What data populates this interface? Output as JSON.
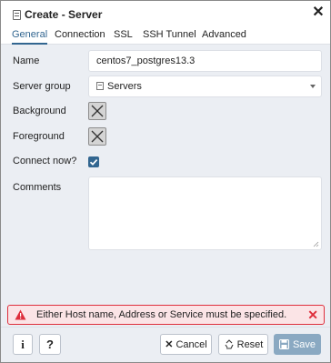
{
  "dialog": {
    "title": "Create - Server",
    "close_glyph": "✕"
  },
  "tabs": [
    {
      "label": "General",
      "active": true
    },
    {
      "label": "Connection",
      "active": false
    },
    {
      "label": "SSL",
      "active": false
    },
    {
      "label": "SSH Tunnel",
      "active": false
    },
    {
      "label": "Advanced",
      "active": false
    }
  ],
  "form": {
    "name": {
      "label": "Name",
      "value": "centos7_postgres13.3"
    },
    "server_group": {
      "label": "Server group",
      "value": "Servers"
    },
    "background": {
      "label": "Background"
    },
    "foreground": {
      "label": "Foreground"
    },
    "connect_now": {
      "label": "Connect now?",
      "checked": true
    },
    "comments": {
      "label": "Comments",
      "value": ""
    }
  },
  "alert": {
    "message": "Either Host name, Address or Service must be specified.",
    "close_glyph": "✕",
    "color": "#de2f3c"
  },
  "footer": {
    "info_glyph": "i",
    "help_glyph": "?",
    "cancel_label": "Cancel",
    "reset_label": "Reset",
    "save_label": "Save"
  },
  "colors": {
    "accent": "#326690",
    "save_disabled": "#8aa9c2",
    "danger": "#de2f3c"
  }
}
